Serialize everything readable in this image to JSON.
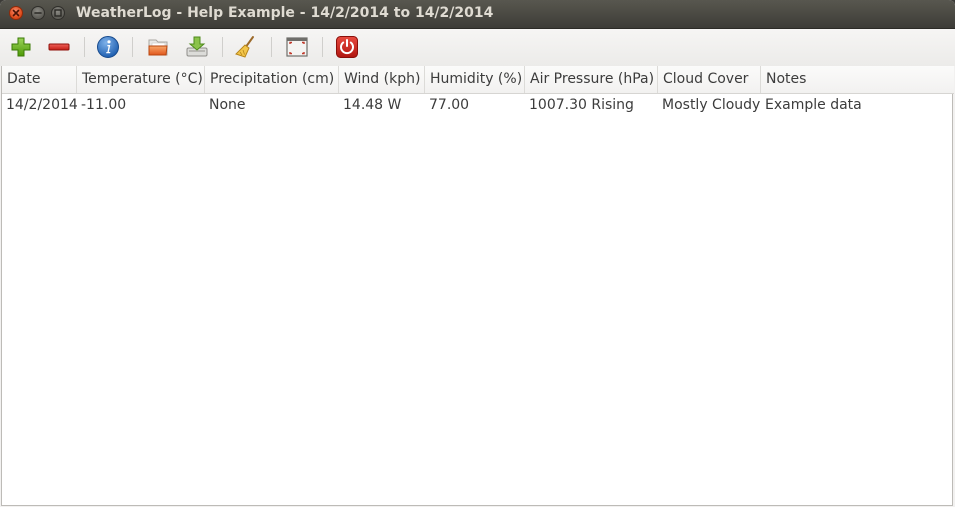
{
  "window": {
    "title": "WeatherLog - Help Example - 14/2/2014 to 14/2/2014"
  },
  "toolbar": {
    "buttons": [
      {
        "icon": "add-icon"
      },
      {
        "icon": "remove-icon"
      },
      {
        "icon": "info-icon"
      },
      {
        "icon": "open-folder-icon"
      },
      {
        "icon": "save-icon"
      },
      {
        "icon": "clear-broom-icon"
      },
      {
        "icon": "fullscreen-icon"
      },
      {
        "icon": "power-icon"
      }
    ]
  },
  "table": {
    "columns": [
      "Date",
      "Temperature (°C)",
      "Precipitation (cm)",
      "Wind (kph)",
      "Humidity (%)",
      "Air Pressure (hPa)",
      "Cloud Cover",
      "Notes"
    ],
    "rows": [
      [
        "14/2/2014",
        "-11.00",
        "None",
        "14.48 W",
        "77.00",
        "1007.30 Rising",
        "Mostly Cloudy",
        "Example data"
      ]
    ]
  },
  "colors": {
    "titlebar": "#3d3c37",
    "close_button": "#e04e1f",
    "power_button": "#cc1f1f"
  }
}
